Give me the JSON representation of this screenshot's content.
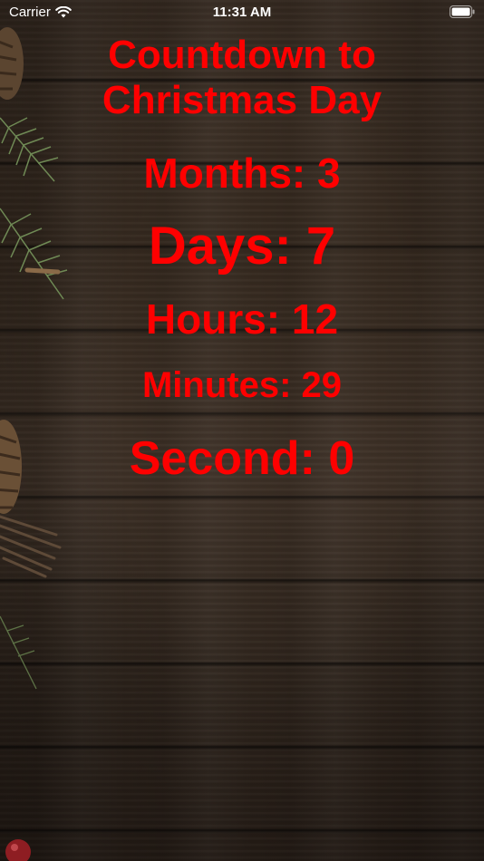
{
  "status_bar": {
    "carrier": "Carrier",
    "time": "11:31 AM",
    "wifi_icon": "wifi-icon",
    "battery_icon": "battery-icon"
  },
  "countdown": {
    "title_line1": "Countdown to",
    "title_line2": "Christmas Day",
    "months": "Months: 3",
    "days": "Days: 7",
    "hours": "Hours: 12",
    "minutes": "Minutes: 29",
    "seconds": "Second: 0"
  },
  "colors": {
    "text": "#ff0000",
    "background": "#3a2d22",
    "status_text": "#ffffff"
  },
  "decorations": {
    "icons": [
      "pine-branch-icon",
      "pinecone-icon",
      "twig-bundle-icon",
      "berry-icon"
    ]
  }
}
